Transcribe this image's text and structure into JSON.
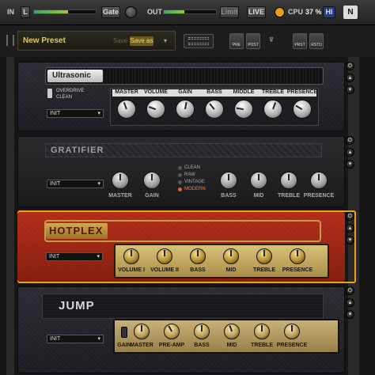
{
  "topbar": {
    "in_label": "IN",
    "in_channel": "L",
    "gate_label": "Gate",
    "out_label": "OUT",
    "limit_label": "Limit",
    "live_label": "LIVE",
    "cpu_label": "CPU",
    "cpu_value": "37 %",
    "hi_label": "HI",
    "in_level": 0.55,
    "out_level": 0.4
  },
  "presetbar": {
    "preset_name": "New Preset",
    "save_label": "Save",
    "save_as_label": "Save as",
    "icons": [
      "PRE",
      "POST",
      "PRST",
      "RSTD"
    ]
  },
  "colors": {
    "accent_yellow": "#e8c85a",
    "hotplex_red": "#b32d1a",
    "selected_orange": "#f0a020"
  },
  "amps": [
    {
      "name": "Ultrasonic",
      "preset": "INIT",
      "switch_label_top": "OVERDRIVE",
      "switch_label_bottom": "CLEAN",
      "knobs": [
        "MASTER",
        "VOLUME",
        "GAIN",
        "BASS",
        "MIDDLE",
        "TREBLE",
        "PRESENCE"
      ]
    },
    {
      "name": "GRATIFIER",
      "preset": "INIT",
      "modes": [
        "CLEAN",
        "RAW",
        "VINTAGE",
        "MODERN"
      ],
      "active_mode": "MODERN",
      "knobs_left": [
        "MASTER",
        "GAIN"
      ],
      "knobs_right": [
        "BASS",
        "MID",
        "TREBLE",
        "PRESENCE"
      ]
    },
    {
      "name": "HOTPLEX",
      "preset": "INIT",
      "knobs": [
        "VOLUME I",
        "VOLUME II",
        "BASS",
        "MID",
        "TREBLE",
        "PRESENCE"
      ]
    },
    {
      "name": "JUMP",
      "preset": "INIT",
      "knobs": [
        "GAIN",
        "MASTER",
        "PRE-AMP",
        "BASS",
        "MID",
        "TREBLE",
        "PRESENCE"
      ]
    }
  ]
}
